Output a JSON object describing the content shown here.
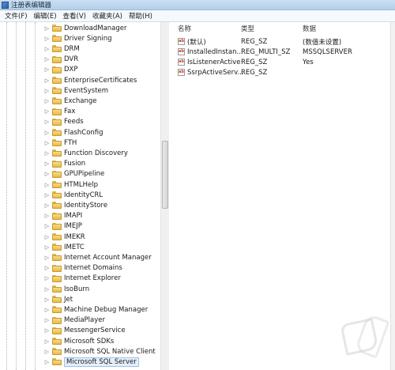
{
  "window": {
    "title": "注册表编辑器"
  },
  "menu": [
    "文件(F)",
    "编辑(E)",
    "查看(V)",
    "收藏夹(A)",
    "帮助(H)"
  ],
  "tree": {
    "items": [
      "DownloadManager",
      "Driver Signing",
      "DRM",
      "DVR",
      "DXP",
      "EnterpriseCertificates",
      "EventSystem",
      "Exchange",
      "Fax",
      "Feeds",
      "FlashConfig",
      "FTH",
      "Function Discovery",
      "Fusion",
      "GPUPipeline",
      "HTMLHelp",
      "IdentityCRL",
      "IdentityStore",
      "IMAPI",
      "IMEJP",
      "IMEKR",
      "IMETC",
      "Internet Account Manager",
      "Internet Domains",
      "Internet Explorer",
      "IsoBurn",
      "Jet",
      "Machine Debug Manager",
      "MediaPlayer",
      "MessengerService",
      "Microsoft SDKs",
      "Microsoft SQL Native Client",
      "Microsoft SQL Server"
    ],
    "selected": "Microsoft SQL Server"
  },
  "values_pane": {
    "headers": {
      "name": "名称",
      "type": "类型",
      "data": "数据"
    },
    "rows": [
      {
        "icon": "ab",
        "name": "(默认)",
        "type": "REG_SZ",
        "data": "(数值未设置)"
      },
      {
        "icon": "ab",
        "name": "InstalledInstan...",
        "type": "REG_MULTI_SZ",
        "data": "MSSQLSERVER"
      },
      {
        "icon": "ab",
        "name": "IsListenerActive",
        "type": "REG_SZ",
        "data": "Yes"
      },
      {
        "icon": "ab",
        "name": "SsrpActiveServ...",
        "type": "REG_SZ",
        "data": ""
      }
    ]
  },
  "icons": {
    "folder": "folder-icon",
    "string_value": "string-value-icon",
    "app": "registry-editor-icon"
  },
  "colors": {
    "folder": "#e9b94a",
    "selection": "#e3eefb",
    "titlebar": "#c9dff3"
  }
}
